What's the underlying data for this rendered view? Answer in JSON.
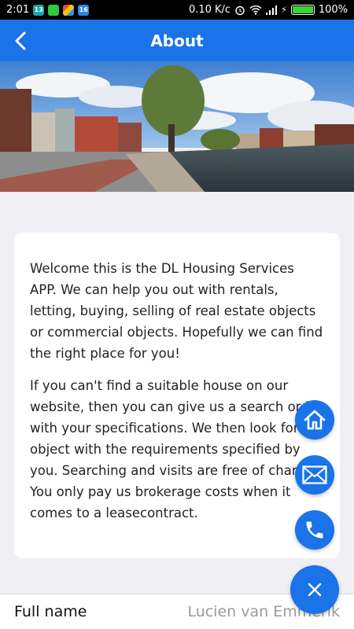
{
  "status_bar": {
    "time": "2:01",
    "notifications": [
      "13",
      "",
      "",
      "16"
    ],
    "network_speed": "0.10 K/c",
    "battery": "100%"
  },
  "app_bar": {
    "title": "About",
    "back_icon": "back-arrow-icon"
  },
  "hero": {
    "icon": "canal-city-photo"
  },
  "content": {
    "paragraphs": [
      "Welcome this is the DL Housing Services APP. We can help you out with rentals, letting, buying, selling of real estate objects or commercial objects. Hopefully we can find the right place for you!",
      "If you can't find a suitable house on our website, then you can give us a search order with your specifications. We then look for the object with the requirements specified by you. Searching and visits are free of charge. You only pay us brokerage costs when it comes to a leasecontract."
    ]
  },
  "form": {
    "full_name_label": "Full name",
    "full_name_value": "Lucien van Emmerik"
  },
  "fab_menu": {
    "items": [
      {
        "icon": "home-icon"
      },
      {
        "icon": "mail-icon"
      },
      {
        "icon": "phone-icon"
      }
    ],
    "close_icon": "close-icon"
  },
  "colors": {
    "accent": "#1a73e8",
    "background": "#efeff4"
  }
}
